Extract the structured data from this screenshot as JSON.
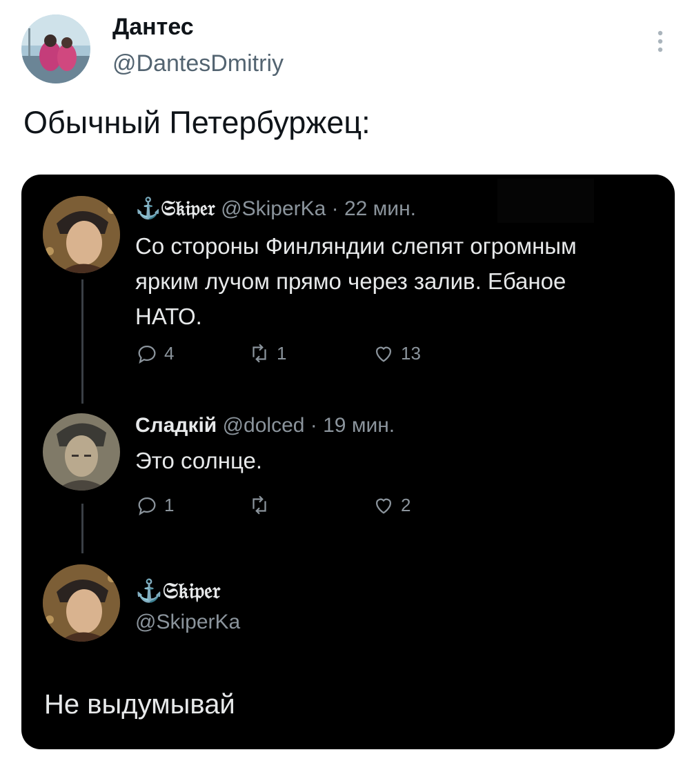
{
  "tweet": {
    "author_name": "Дантес",
    "author_handle": "@DantesDmitriy",
    "text": "Обычный Петербуржец:"
  },
  "screenshot": {
    "replies": [
      {
        "name": "⚓𝔖𝔨𝔦𝔭𝔢𝔯",
        "handle": "@SkiperKa",
        "time": "· 22 мин.",
        "text": "Со стороны Финляндии слепят огромным ярким лучом прямо через залив. Ебаное НАТО.",
        "replies_count": "4",
        "retweets_count": "1",
        "likes_count": "13"
      },
      {
        "name": "Сладкій",
        "handle": "@dolced",
        "time": "· 19 мин.",
        "text": "Это солнце.",
        "replies_count": "1",
        "retweets_count": "",
        "likes_count": "2"
      }
    ],
    "final": {
      "name": "⚓𝔖𝔨𝔦𝔭𝔢𝔯",
      "handle": "@SkiperKa",
      "text": "Не выдумывай"
    }
  },
  "icons": {
    "more": "more-vertical-icon",
    "reply": "reply-icon",
    "retweet": "retweet-icon",
    "like": "heart-icon"
  }
}
